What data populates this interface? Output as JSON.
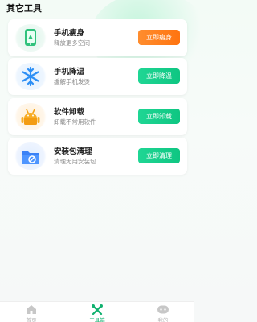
{
  "section_title": "其它工具",
  "colors": {
    "orange_button": "#ff8012",
    "green_button": "#12cc8a",
    "active_tab": "#10b16f"
  },
  "tools": [
    {
      "icon": "phone-slim-icon",
      "title": "手机瘦身",
      "subtitle": "释放更多空间",
      "button": "立即瘦身"
    },
    {
      "icon": "snowflake-icon",
      "title": "手机降温",
      "subtitle": "缓解手机发烫",
      "button": "立即降温"
    },
    {
      "icon": "android-uninstall-icon",
      "title": "软件卸载",
      "subtitle": "卸载不常用软件",
      "button": "立即卸载"
    },
    {
      "icon": "folder-clean-icon",
      "title": "安装包清理",
      "subtitle": "清理无用安装包",
      "button": "立即清理"
    }
  ],
  "tabbar": [
    {
      "icon": "home-icon",
      "label": "首页",
      "active": false
    },
    {
      "icon": "tools-icon",
      "label": "工具箱",
      "active": true
    },
    {
      "icon": "mine-icon",
      "label": "我的",
      "active": false
    }
  ]
}
